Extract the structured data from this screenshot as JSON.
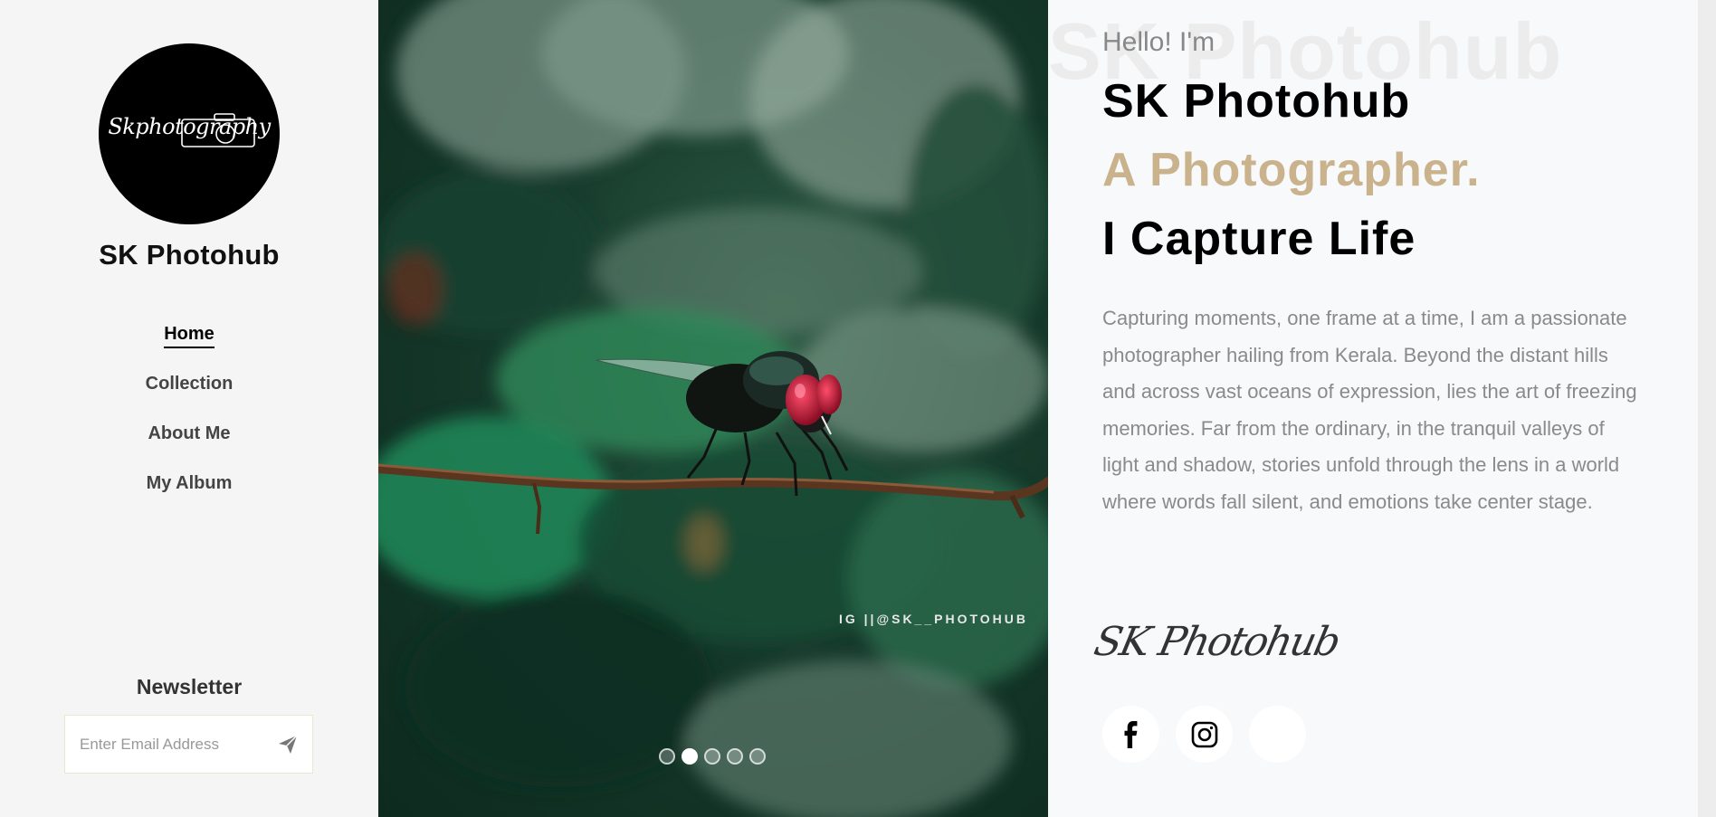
{
  "sidebar": {
    "logo_text": "Skphotography",
    "site_name": "SK Photohub",
    "nav": [
      {
        "label": "Home",
        "active": true
      },
      {
        "label": "Collection",
        "active": false
      },
      {
        "label": "About Me",
        "active": false
      },
      {
        "label": "My Album",
        "active": false
      }
    ],
    "newsletter": {
      "title": "Newsletter",
      "placeholder": "Enter Email Address",
      "value": ""
    }
  },
  "slider": {
    "watermark": "IG ||@SK__PHOTOHUB",
    "total_slides": 5,
    "active_slide": 2,
    "image_subject": "fly-on-branch"
  },
  "hero": {
    "background_word": "SK Photohub",
    "greeting": "Hello! I'm",
    "name": "SK Photohub",
    "role": "A Photographer.",
    "tagline": "I Capture Life",
    "bio": "Capturing moments, one frame at a time, I am a passionate photographer hailing from Kerala. Beyond the distant hills and across vast oceans of expression, lies the art of freezing memories. Far from the ordinary, in the tranquil valleys of light and shadow, stories unfold through the lens in a world where words fall silent, and emotions take center stage.",
    "signature": "SK Photohub",
    "socials": [
      {
        "icon": "facebook-icon"
      },
      {
        "icon": "instagram-icon"
      },
      {
        "icon": "blank"
      }
    ]
  },
  "colors": {
    "accent": "#c9b28c",
    "sidebar_bg": "#f5f5f5",
    "content_bg": "#f8f9fa",
    "bio_text": "#8a8a8a"
  }
}
